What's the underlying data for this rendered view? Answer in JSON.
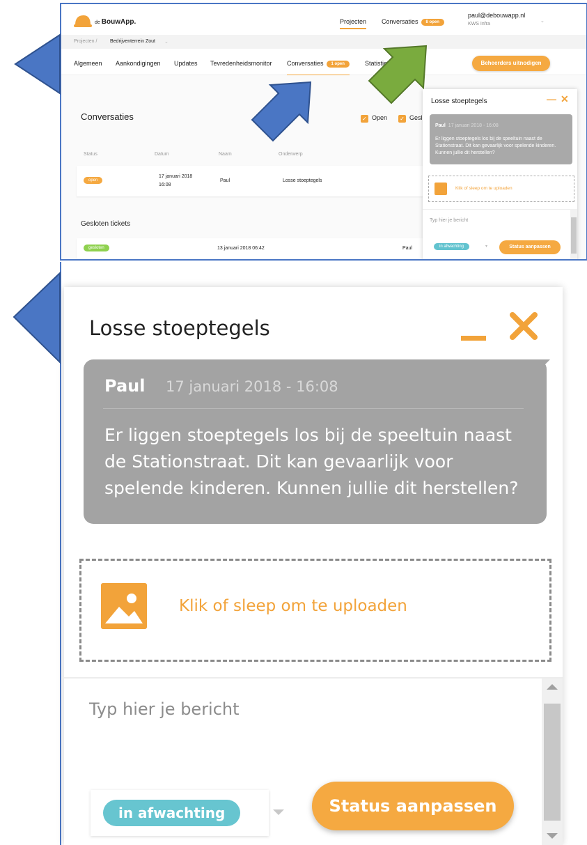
{
  "app": {
    "logo_prefix": "de",
    "logo_name": "BouwApp.",
    "nav": [
      {
        "label": "Projecten"
      },
      {
        "label": "Conversaties",
        "badge": "8 open"
      }
    ],
    "user_email": "paul@debouwapp.nl",
    "user_org": "KWS Infra"
  },
  "breadcrumb": {
    "root": "Projecten /",
    "current": "Bedrijventerrein Zout"
  },
  "tabs": [
    {
      "label": "Algemeen"
    },
    {
      "label": "Aankondigingen"
    },
    {
      "label": "Updates"
    },
    {
      "label": "Tevredenheidsmonitor"
    },
    {
      "label": "Conversaties",
      "badge": "1 open"
    },
    {
      "label": "Statistieken"
    }
  ],
  "invite_button": "Beheerders uitnodigen",
  "page": {
    "title": "Conversaties",
    "filters": [
      {
        "label": "Open",
        "checked": true
      },
      {
        "label": "Gesl",
        "checked": true
      }
    ],
    "columns": [
      "Status",
      "Datum",
      "Naam",
      "Onderwerp"
    ],
    "open_rows": [
      {
        "status": "open",
        "date_line1": "17 januari 2018",
        "date_line2": "16:08",
        "name": "Paul",
        "subject": "Losse stoeptegels"
      }
    ],
    "closed_title": "Gesloten tickets",
    "closed_rows": [
      {
        "status": "gesloten",
        "date": "13 januari 2018 06:42",
        "name": "Paul"
      }
    ]
  },
  "chat": {
    "title": "Losse stoeptegels",
    "message": {
      "author": "Paul",
      "timestamp": "17 januari 2018 - 16:08",
      "text": "Er liggen stoeptegels los bij de speeltuin naast de Stationstraat. Dit kan gevaarlijk voor spelende kinderen. Kunnen jullie dit herstellen?"
    },
    "upload_label": "Klik of sleep om te uploaden",
    "input_placeholder": "Typ hier je bericht",
    "status_value": "in afwachting",
    "status_button": "Status aanpassen"
  },
  "colors": {
    "accent": "#f2a33a",
    "status_pending": "#67c5d0",
    "status_closed": "#8fd14f",
    "bubble": "#a3a3a3",
    "annotation_blue": "#4a76c4",
    "annotation_green": "#7aab3e"
  }
}
